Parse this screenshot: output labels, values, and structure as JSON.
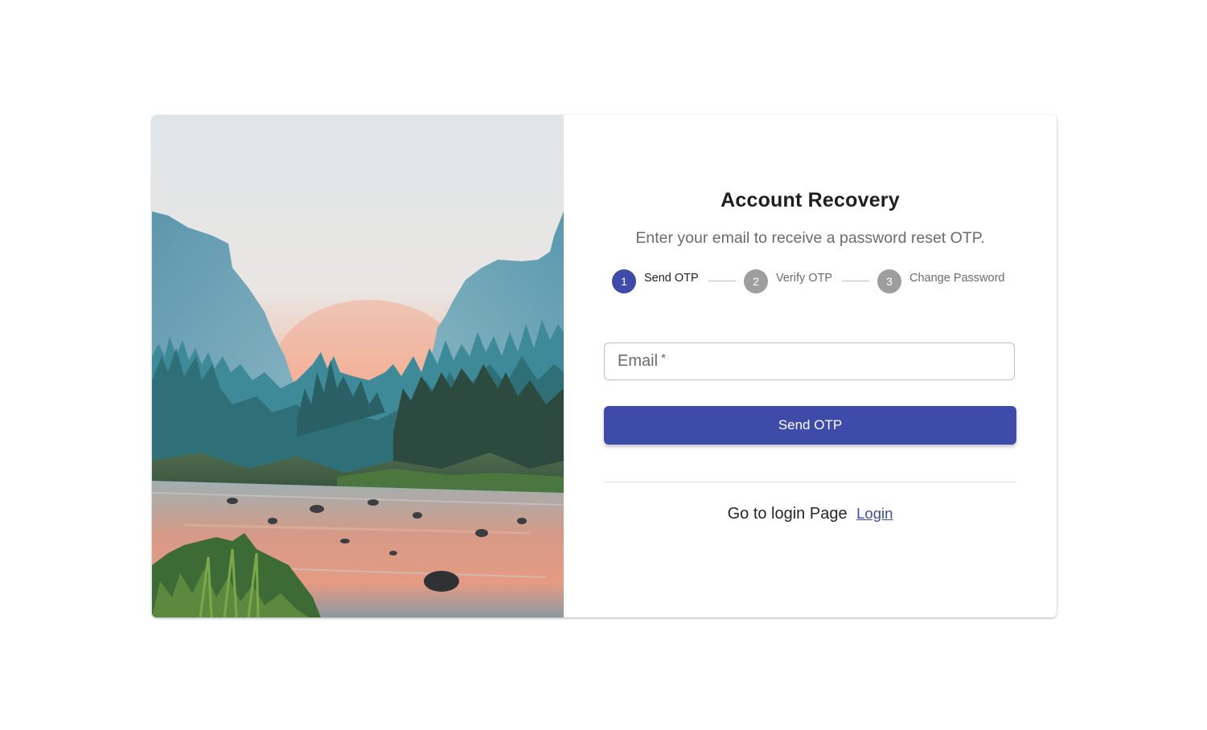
{
  "page": {
    "title": "Account Recovery",
    "subtitle": "Enter your email to receive a password reset OTP."
  },
  "stepper": {
    "steps": [
      {
        "number": "1",
        "label": "Send OTP",
        "state": "active"
      },
      {
        "number": "2",
        "label": "Verify OTP",
        "state": "inactive"
      },
      {
        "number": "3",
        "label": "Change Password",
        "state": "inactive"
      }
    ]
  },
  "form": {
    "email_label": "Email",
    "email_required_mark": "*",
    "email_value": "",
    "submit_label": "Send OTP"
  },
  "footer": {
    "prompt": "Go to login Page",
    "link_label": "Login"
  },
  "hero_image": {
    "subject": "mountain valley river landscape at sunrise"
  },
  "colors": {
    "primary": "#3f4ba8",
    "step_active": "#3f4ba8",
    "step_inactive": "#9e9e9e",
    "subtitle_text": "#6b6b6b",
    "border": "#bdbdbd"
  }
}
